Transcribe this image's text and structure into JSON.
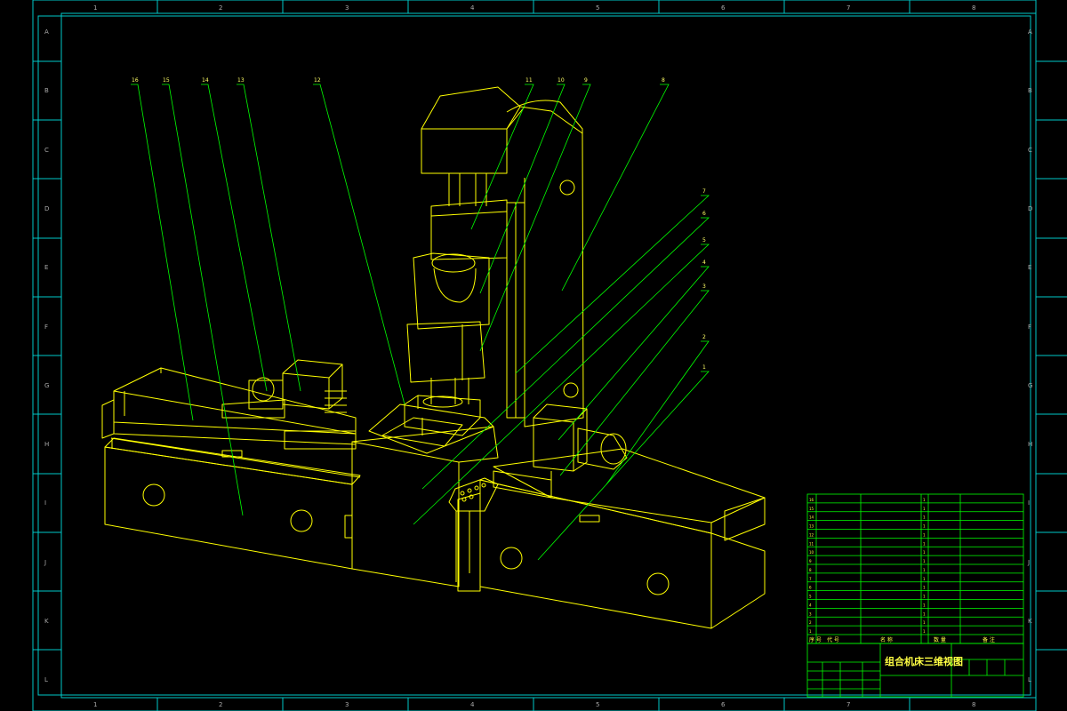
{
  "drawing": {
    "title": "组合机床三维视图",
    "colors": {
      "frame": "#00c8c8",
      "geometry": "#ffff00",
      "leader": "#00ff00",
      "background": "#000000"
    }
  },
  "frame": {
    "columns": [
      "1",
      "2",
      "3",
      "4",
      "5",
      "6",
      "7",
      "8"
    ],
    "rows": [
      "A",
      "B",
      "C",
      "D",
      "E",
      "F",
      "G",
      "H",
      "I",
      "J",
      "K",
      "L"
    ]
  },
  "callouts": {
    "c1": "1",
    "c2": "2",
    "c3": "3",
    "c4": "4",
    "c5": "5",
    "c6": "6",
    "c7": "7",
    "c8": "8",
    "c9": "9",
    "c10": "10",
    "c11": "11",
    "c12": "12",
    "c13": "13",
    "c14": "14",
    "c15": "15",
    "c16": "16"
  },
  "bom": {
    "rows": [
      {
        "no": "16",
        "code": "",
        "name": "",
        "qty": "1",
        "remark": ""
      },
      {
        "no": "15",
        "code": "",
        "name": "",
        "qty": "1",
        "remark": ""
      },
      {
        "no": "14",
        "code": "",
        "name": "",
        "qty": "1",
        "remark": ""
      },
      {
        "no": "13",
        "code": "",
        "name": "",
        "qty": "1",
        "remark": ""
      },
      {
        "no": "12",
        "code": "",
        "name": "",
        "qty": "1",
        "remark": ""
      },
      {
        "no": "11",
        "code": "",
        "name": "",
        "qty": "1",
        "remark": ""
      },
      {
        "no": "10",
        "code": "",
        "name": "",
        "qty": "1",
        "remark": ""
      },
      {
        "no": "9",
        "code": "",
        "name": "",
        "qty": "1",
        "remark": ""
      },
      {
        "no": "8",
        "code": "",
        "name": "",
        "qty": "1",
        "remark": ""
      },
      {
        "no": "7",
        "code": "",
        "name": "",
        "qty": "1",
        "remark": ""
      },
      {
        "no": "6",
        "code": "",
        "name": "",
        "qty": "1",
        "remark": ""
      },
      {
        "no": "5",
        "code": "",
        "name": "",
        "qty": "1",
        "remark": ""
      },
      {
        "no": "4",
        "code": "",
        "name": "",
        "qty": "1",
        "remark": ""
      },
      {
        "no": "3",
        "code": "",
        "name": "",
        "qty": "1",
        "remark": ""
      },
      {
        "no": "2",
        "code": "",
        "name": "",
        "qty": "1",
        "remark": ""
      },
      {
        "no": "1",
        "code": "",
        "name": "",
        "qty": "1",
        "remark": ""
      }
    ],
    "header": {
      "no": "序 号",
      "code": "代 号",
      "name": "名 称",
      "qty": "数 量",
      "remark": "备 注"
    }
  }
}
